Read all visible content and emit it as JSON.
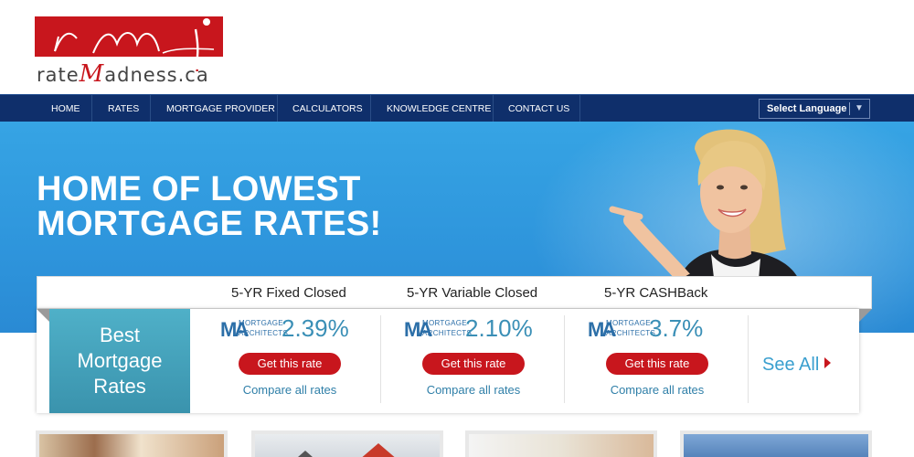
{
  "logo": {
    "script_text": "rmi",
    "word_prefix": "rate",
    "word_m": "M",
    "word_suffix": "adness.ca"
  },
  "nav": {
    "items": [
      "HOME",
      "RATES",
      "MORTGAGE PROVIDER",
      "CALCULATORS",
      "KNOWLEDGE CENTRE",
      "CONTACT US"
    ],
    "language_select": "Select Language",
    "language_arrow": "▼"
  },
  "hero": {
    "title_line1": "HOME OF LOWEST",
    "title_line2": "MORTGAGE RATES!"
  },
  "rates": {
    "best_line1": "Best",
    "best_line2": "Mortgage",
    "best_line3": "Rates",
    "columns": [
      {
        "heading": "5-YR Fixed Closed",
        "provider_line1": "MORTGAGE",
        "provider_line2": "ARCHITECTS",
        "rate": "2.39%",
        "button": "Get this rate",
        "compare": "Compare all rates"
      },
      {
        "heading": "5-YR Variable Closed",
        "provider_line1": "MORTGAGE",
        "provider_line2": "ARCHITECTS",
        "rate": "2.10%",
        "button": "Get this rate",
        "compare": "Compare all rates"
      },
      {
        "heading": "5-YR CASHBack",
        "provider_line1": "MORTGAGE",
        "provider_line2": "ARCHITECTS",
        "rate": "3.7%",
        "button": "Get this rate",
        "compare": "Compare all rates"
      }
    ],
    "see_all": "See All"
  },
  "colors": {
    "brand_red": "#c8161d",
    "nav_blue": "#0f2f6b",
    "hero_blue": "#36a4e4",
    "rate_blue": "#3a8fb6"
  }
}
